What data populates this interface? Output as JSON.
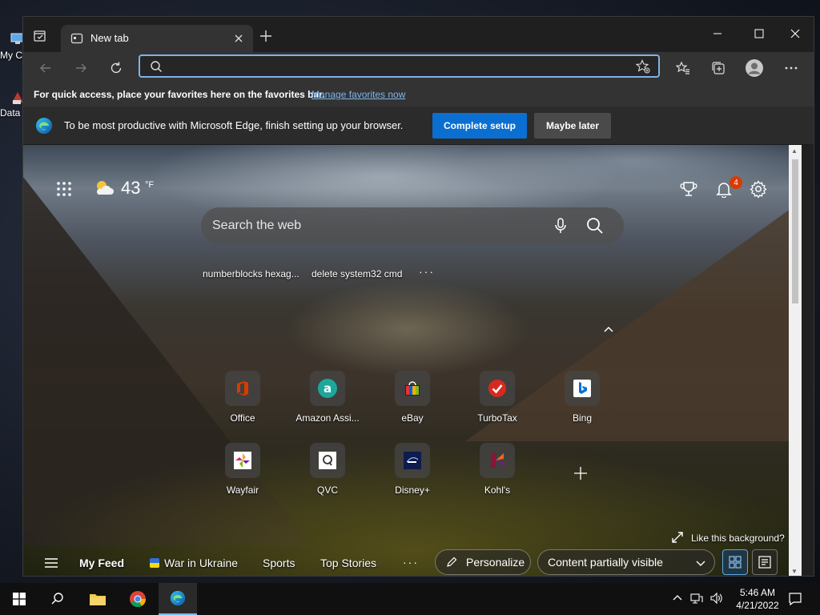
{
  "desktop": {
    "icons": [
      {
        "label": "My C"
      },
      {
        "label": "Data"
      }
    ]
  },
  "browser": {
    "tab": {
      "title": "New tab"
    },
    "address_bar": {
      "value": "",
      "placeholder": ""
    },
    "favorites_bar": {
      "message": "For quick access, place your favorites here on the favorites bar.",
      "link": "Manage favorites now"
    },
    "setup_bar": {
      "message": "To be most productive with Microsoft Edge, finish setting up your browser.",
      "primary_button": "Complete setup",
      "secondary_button": "Maybe later"
    }
  },
  "newtab": {
    "weather": {
      "temperature": "43",
      "unit": "°F"
    },
    "notifications_count": "4",
    "search": {
      "placeholder": "Search the web"
    },
    "trending": [
      "numberblocks hexag...",
      "delete system32 cmd"
    ],
    "quick_links": [
      {
        "label": "Office",
        "icon": "office-icon",
        "color": "#d83b01"
      },
      {
        "label": "Amazon Assi...",
        "icon": "amazon-assistant-icon",
        "color": "#1ba89b"
      },
      {
        "label": "eBay",
        "icon": "ebay-icon",
        "color": "#e53238"
      },
      {
        "label": "TurboTax",
        "icon": "turbotax-icon",
        "color": "#d52b1e"
      },
      {
        "label": "Bing",
        "icon": "bing-icon",
        "color": "#0a6fd1"
      },
      {
        "label": "Wayfair",
        "icon": "wayfair-icon",
        "color": "#7b189f"
      },
      {
        "label": "QVC",
        "icon": "qvc-icon",
        "color": "#ffffff"
      },
      {
        "label": "Disney+",
        "icon": "disney-plus-icon",
        "color": "#0e1b4d"
      },
      {
        "label": "Kohl's",
        "icon": "kohls-icon",
        "color": "#8a1538"
      }
    ],
    "like_background": "Like this background?",
    "feed": {
      "my_feed": "My Feed",
      "war_in_ukraine": "War in Ukraine",
      "sports": "Sports",
      "top_stories": "Top Stories",
      "personalize": "Personalize",
      "content_visibility": "Content partially visible"
    }
  },
  "taskbar": {
    "time": "5:46 AM",
    "date": "4/21/2022"
  },
  "colors": {
    "accent": "#0a6fd1",
    "link": "#7fb6ee",
    "address_focus": "#7fb2e5",
    "badge": "#d83b01"
  }
}
